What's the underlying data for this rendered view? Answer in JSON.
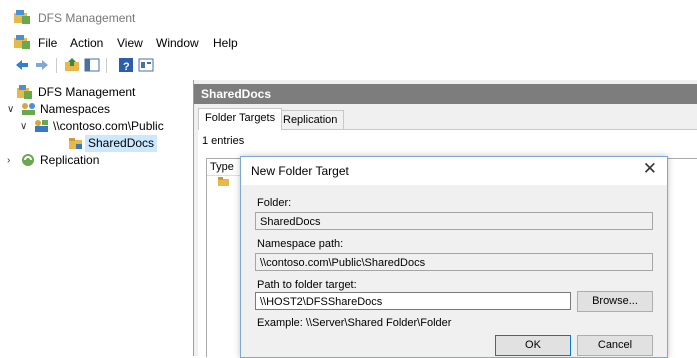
{
  "window": {
    "title": "DFS Management"
  },
  "menu": [
    "File",
    "Action",
    "View",
    "Window",
    "Help"
  ],
  "toolbar": [
    "back-arrow-icon",
    "forward-arrow-icon",
    "up-folder-icon",
    "show-hide-tree-icon",
    "help-icon",
    "properties-icon"
  ],
  "tree": {
    "root": "DFS Management",
    "namespaces": "Namespaces",
    "namespace_item": "\\\\contoso.com\\Public",
    "folder": "SharedDocs",
    "replication": "Replication"
  },
  "detail": {
    "header": "SharedDocs",
    "tabs": [
      "Folder Targets",
      "Replication"
    ],
    "entries": "1 entries",
    "column_type": "Type"
  },
  "dialog": {
    "title": "New Folder Target",
    "folder_label": "Folder:",
    "folder_value": "SharedDocs",
    "namespace_label": "Namespace path:",
    "namespace_value": "\\\\contoso.com\\Public\\SharedDocs",
    "target_label": "Path to folder target:",
    "target_value": "\\\\HOST2\\DFSShareDocs",
    "browse": "Browse...",
    "example": "Example: \\\\Server\\Shared Folder\\Folder",
    "ok": "OK",
    "cancel": "Cancel"
  },
  "colors": {
    "accent": "#0078d7",
    "selection": "#cce8ff",
    "header": "#7d7d7d"
  }
}
